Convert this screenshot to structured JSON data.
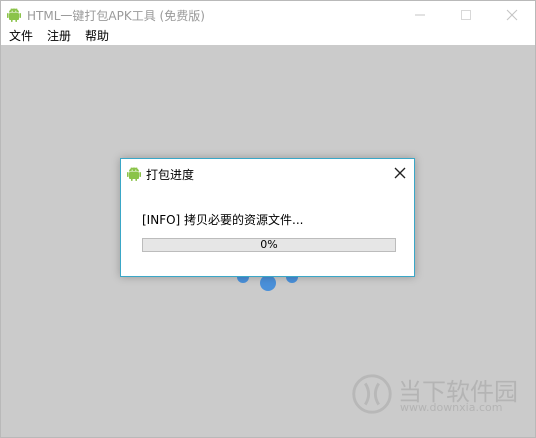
{
  "window": {
    "title": "HTML一键打包APK工具 (免费版)"
  },
  "menu": [
    "文件",
    "注册",
    "帮助"
  ],
  "dialog": {
    "title": "打包进度",
    "message": "[INFO] 拷贝必要的资源文件...",
    "progress": {
      "fraction": 0,
      "label": "0%"
    }
  },
  "watermark": {
    "site_name": "当下软件园",
    "url": "www.downxia.com"
  },
  "colors": {
    "android_green": "#8bc34a",
    "dialog_border": "#3aa7c7",
    "spinner_blue": "#4a90d9",
    "background_gray": "#cbcbcb"
  }
}
